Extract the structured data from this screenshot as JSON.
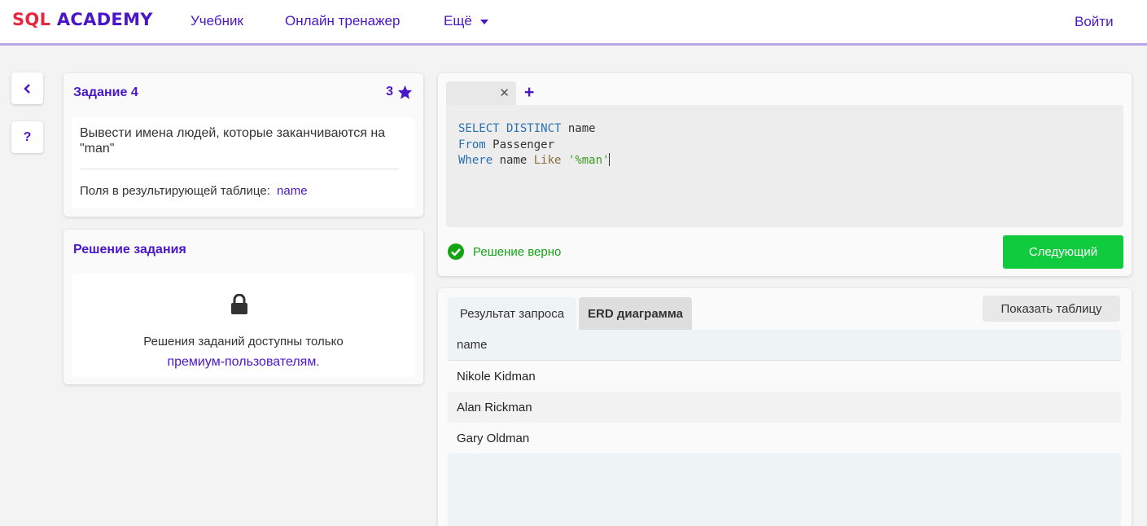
{
  "header": {
    "logo_sql": "SQL",
    "logo_academy": " ACADEMY",
    "nav": [
      "Учебник",
      "Онлайн тренажер",
      "Ещё"
    ],
    "login": "Войти"
  },
  "sidebar_buttons": {
    "back": "‹",
    "help": "?"
  },
  "task": {
    "title": "Задание 4",
    "score": "3",
    "description": "Вывести имена людей, которые заканчиваются на \"man\"",
    "fields_label": "Поля в результирующей таблице:",
    "fields_value": "name"
  },
  "solution": {
    "title": "Решение задания",
    "locked_text": "Решения заданий доступны только",
    "locked_link": "премиум-пользователям",
    "locked_suffix": "."
  },
  "editor": {
    "code_lines": [
      [
        {
          "t": "SELECT DISTINCT",
          "c": "kw"
        },
        {
          "t": " name",
          "c": ""
        }
      ],
      [
        {
          "t": "From",
          "c": "kw"
        },
        {
          "t": " Passenger",
          "c": ""
        }
      ],
      [
        {
          "t": "Where",
          "c": "kw"
        },
        {
          "t": " name ",
          "c": ""
        },
        {
          "t": "Like",
          "c": "fn"
        },
        {
          "t": " ",
          "c": ""
        },
        {
          "t": "'%man'",
          "c": "str"
        }
      ]
    ],
    "status": "Решение верно",
    "next_button": "Следующий",
    "status_color": "#14a314",
    "accent": "#4a16c9"
  },
  "results": {
    "tabs": [
      "Результат запроса",
      "ERD диаграмма"
    ],
    "show_table_button": "Показать таблицу",
    "columns": [
      "name"
    ],
    "rows": [
      "Nikole Kidman",
      "Alan Rickman",
      "Gary Oldman"
    ]
  }
}
